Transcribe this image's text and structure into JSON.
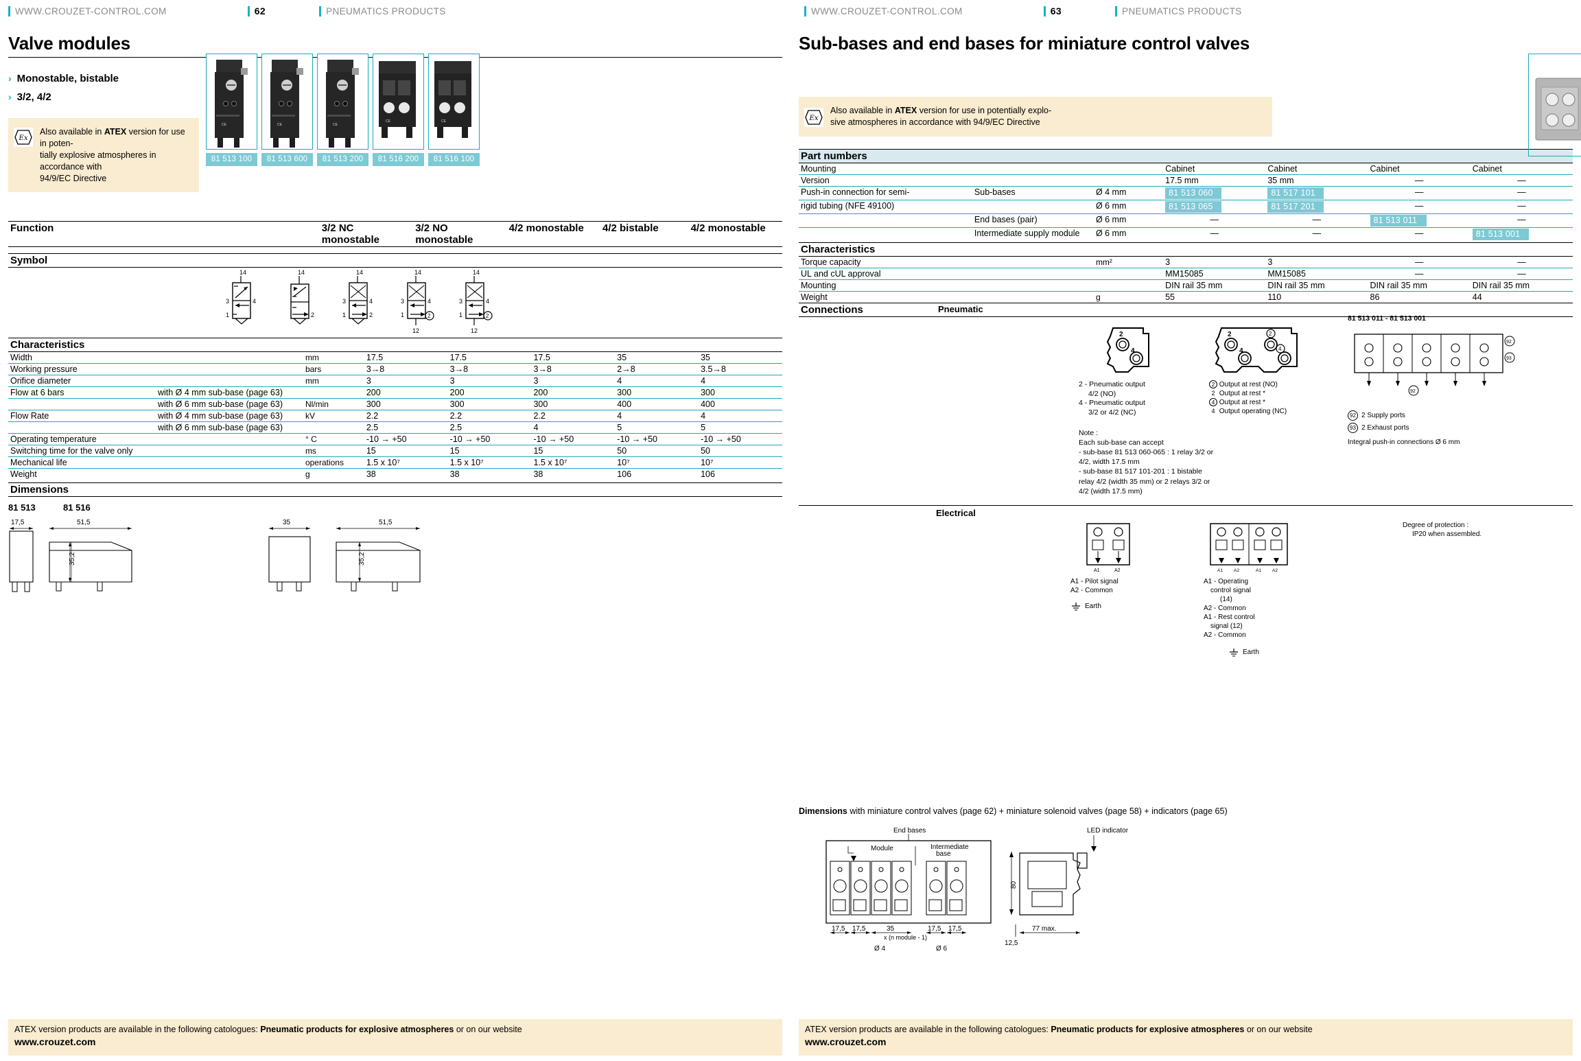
{
  "left_page": {
    "runhead": {
      "url": "WWW.CROUZET-CONTROL.COM",
      "page": "62",
      "category": "PNEUMATICS PRODUCTS"
    },
    "title": "Valve modules",
    "bullets": [
      "Monostable, bistable",
      "3/2, 4/2"
    ],
    "atex": {
      "icon": "ex-icon",
      "line1_pre": "Also available in ",
      "line1_bold": "ATEX",
      "line1_post": " version for use in poten-",
      "line2": "tially explosive atmospheres in accordance with",
      "line3": "94/9/EC Directive"
    },
    "products": [
      {
        "part": "81 513 100"
      },
      {
        "part": "81 513 600"
      },
      {
        "part": "81 513 200"
      },
      {
        "part": "81 516 200"
      },
      {
        "part": "81 516 100"
      }
    ],
    "function": {
      "label": "Function",
      "values": [
        "3/2 NC monostable",
        "3/2 NO monostable",
        "4/2 monostable",
        "4/2 bistable",
        "4/2 monostable"
      ]
    },
    "symbol": {
      "label": "Symbol",
      "ports": [
        {
          "top": "14",
          "left": [
            "3",
            "1"
          ],
          "right": [
            "4",
            ""
          ],
          "bottom": ""
        },
        {
          "top": "14",
          "left": [
            "",
            ""
          ],
          "right": [
            "2"
          ],
          "bottom": ""
        },
        {
          "top": "14",
          "left": [
            "3",
            "1"
          ],
          "right": [
            "4",
            "2"
          ],
          "bottom": ""
        },
        {
          "top": "14",
          "left": [
            "3",
            "1"
          ],
          "right": [
            "4",
            "2"
          ],
          "bottom": "12"
        },
        {
          "top": "14",
          "left": [
            "3",
            "1"
          ],
          "right": [
            "4",
            "2"
          ],
          "bottom": "12"
        }
      ]
    },
    "characteristics": {
      "label": "Characteristics",
      "rows": [
        {
          "name": "Width",
          "sub": "",
          "unit": "mm",
          "values": [
            "17.5",
            "17.5",
            "17.5",
            "35",
            "35"
          ]
        },
        {
          "name": "Working pressure",
          "sub": "",
          "unit": "bars",
          "values": [
            "3→8",
            "3→8",
            "3→8",
            "2→8",
            "3.5→8"
          ]
        },
        {
          "name": "Orifice diameter",
          "sub": "",
          "unit": "mm",
          "values": [
            "3",
            "3",
            "3",
            "4",
            "4"
          ]
        },
        {
          "name": "Flow at 6 bars",
          "sub": "with Ø 4 mm sub-base (page 63)",
          "unit": "",
          "values": [
            "200",
            "200",
            "200",
            "300",
            "300"
          ]
        },
        {
          "name": "",
          "sub": "with Ø 6 mm sub-base (page 63)",
          "unit": "Nl/min",
          "values": [
            "300",
            "300",
            "300",
            "400",
            "400"
          ]
        },
        {
          "name": "Flow Rate",
          "sub": "with Ø 4 mm sub-base (page 63)",
          "unit": "kV",
          "values": [
            "2.2",
            "2.2",
            "2.2",
            "4",
            "4"
          ]
        },
        {
          "name": "",
          "sub": "with Ø 6 mm sub-base (page 63)",
          "unit": "",
          "values": [
            "2.5",
            "2.5",
            "4",
            "5",
            "5"
          ]
        },
        {
          "name": "Operating temperature",
          "sub": "",
          "unit": "° C",
          "values": [
            "-10 → +50",
            "-10 → +50",
            "-10 → +50",
            "-10 → +50",
            "-10 → +50"
          ]
        },
        {
          "name": "Switching time for the valve only",
          "sub": "",
          "unit": "ms",
          "values": [
            "15",
            "15",
            "15",
            "50",
            "50"
          ]
        },
        {
          "name": "Mechanical life",
          "sub": "",
          "unit": "operations",
          "values": [
            "1.5 x 10⁷",
            "1.5 x 10⁷",
            "1.5 x 10⁷",
            "10⁷",
            "10⁷"
          ]
        },
        {
          "name": "Weight",
          "sub": "",
          "unit": "g",
          "values": [
            "38",
            "38",
            "38",
            "106",
            "106"
          ]
        }
      ]
    },
    "dimensions": {
      "label": "Dimensions",
      "groups": [
        {
          "title": "81 513",
          "dims": [
            "17,5",
            "51,5",
            "35,2"
          ]
        },
        {
          "title": "81 516",
          "dims": [
            "35",
            "51,5",
            "35,2"
          ]
        }
      ]
    },
    "footer": {
      "pre": "ATEX version products are available in the following catologues: ",
      "bold": "Pneumatic products for explosive atmospheres",
      "post": " or on our website",
      "web": "www.crouzet.com"
    }
  },
  "right_page": {
    "runhead": {
      "url": "WWW.CROUZET-CONTROL.COM",
      "page": "63",
      "category": "PNEUMATICS PRODUCTS"
    },
    "title": "Sub-bases and end bases for miniature control valves",
    "atex": {
      "icon": "ex-icon",
      "line1_pre": "Also available in ",
      "line1_bold": "ATEX",
      "line1_post": " version for use in potentially explo-",
      "line2": "sive atmospheres in accordance with  94/9/EC Directive"
    },
    "part_numbers": {
      "label": "Part numbers",
      "rows": [
        {
          "name": "Mounting",
          "mid": "",
          "size": "",
          "values": [
            "Cabinet",
            "Cabinet",
            "Cabinet",
            "Cabinet"
          ],
          "chip": [
            false,
            false,
            false,
            false
          ]
        },
        {
          "name": "Version",
          "mid": "",
          "size": "",
          "values": [
            "17.5 mm",
            "35 mm",
            "—",
            "—"
          ],
          "chip": [
            false,
            false,
            false,
            false
          ]
        },
        {
          "name": "Push-in connection for semi-",
          "mid": "Sub-bases",
          "size": "Ø 4 mm",
          "values": [
            "81 513 060",
            "81 517 101",
            "—",
            "—"
          ],
          "chip": [
            true,
            true,
            false,
            false
          ]
        },
        {
          "name": "rigid tubing (NFE 49100)",
          "mid": "",
          "size": "Ø 6 mm",
          "values": [
            "81 513 065",
            "81 517 201",
            "—",
            "—"
          ],
          "chip": [
            true,
            true,
            false,
            false
          ]
        },
        {
          "name": "",
          "mid": "End bases (pair)",
          "size": "Ø 6 mm",
          "values": [
            "—",
            "—",
            "81 513 011",
            "—"
          ],
          "chip": [
            false,
            false,
            true,
            false
          ]
        },
        {
          "name": "",
          "mid": "Intermediate supply module",
          "size": "Ø 6 mm",
          "values": [
            "—",
            "—",
            "—",
            "81 513 001"
          ],
          "chip": [
            false,
            false,
            false,
            true
          ]
        }
      ]
    },
    "characteristics": {
      "label": "Characteristics",
      "rows": [
        {
          "name": "Torque capacity",
          "unit": "mm²",
          "values": [
            "3",
            "3",
            "—",
            "—"
          ]
        },
        {
          "name": "UL and cUL approval",
          "unit": "",
          "values": [
            "MM15085",
            "MM15085",
            "—",
            "—"
          ]
        },
        {
          "name": "Mounting",
          "unit": "",
          "values": [
            "DIN rail 35 mm",
            "DIN rail 35 mm",
            "DIN rail 35 mm",
            "DIN rail 35 mm"
          ]
        },
        {
          "name": "Weight",
          "unit": "g",
          "values": [
            "55",
            "110",
            "86",
            "44"
          ]
        }
      ]
    },
    "connections": {
      "label": "Connections",
      "pneumatic_label": "Pneumatic",
      "electrical_label": "Electrical",
      "diagram_title": "81 513 011 - 81 513 001",
      "pneu_left_legend": [
        "2 - Pneumatic output",
        "4/2 (NO)",
        "4 - Pneumatic output",
        "3/2 or 4/2 (NC)"
      ],
      "pneu_right_legend": [
        {
          "sym": "2",
          "circled": true,
          "text": "Output at rest (NO)"
        },
        {
          "sym": "2",
          "circled": false,
          "text": "Output at rest  *"
        },
        {
          "sym": "4",
          "circled": true,
          "text": "Output at rest  *"
        },
        {
          "sym": "4",
          "circled": false,
          "text": "Output operating (NC)"
        }
      ],
      "note": [
        "Note :",
        "Each sub-base can accept",
        "- sub-base 81 513 060-065 : 1 relay 3/2 or",
        "4/2, width 17.5 mm",
        "- sub-base 81 517 101-201 : 1 bistable",
        "relay 4/2 (width 35 mm) or 2 relays 3/2 or",
        "4/2 (width 17.5 mm)"
      ],
      "port_legend": [
        {
          "sym": "92",
          "text": "2 Supply ports"
        },
        {
          "sym": "93",
          "text": "2 Exhaust ports"
        }
      ],
      "integral": "Integral push-in connections Ø 6 mm",
      "elec_left_legend": [
        "A1 - Pilot signal",
        "A2 - Common"
      ],
      "elec_left_earth": "Earth",
      "elec_right_legend": [
        "A1 - Operating",
        "control signal",
        "(14)",
        "A2 - Common",
        "A1 - Rest control",
        "signal (12)",
        "A2 - Common"
      ],
      "elec_right_earth": "Earth",
      "protection": [
        "Degree of protection :",
        "IP20 when assembled."
      ]
    },
    "dimensions": {
      "pre": "Dimensions",
      "post": " with miniature control valves (page 62) + miniature solenoid valves (page 58) + indicators (page 65)",
      "labels": {
        "end_bases": "End bases",
        "module": "Module",
        "intermediate_base": "Intermediate base",
        "led_indicator": "LED indicator"
      },
      "dims": [
        "17,5",
        "17,5",
        "35",
        "17,5",
        "17,5",
        "80",
        "12,5",
        "77 max.",
        "x (n module - 1)"
      ],
      "diameters": [
        "Ø 4",
        "Ø 6"
      ]
    },
    "footer": {
      "pre": "ATEX version products are available in the following catologues: ",
      "bold": "Pneumatic products for explosive atmospheres",
      "post": " or on our website",
      "web": "www.crouzet.com"
    }
  }
}
